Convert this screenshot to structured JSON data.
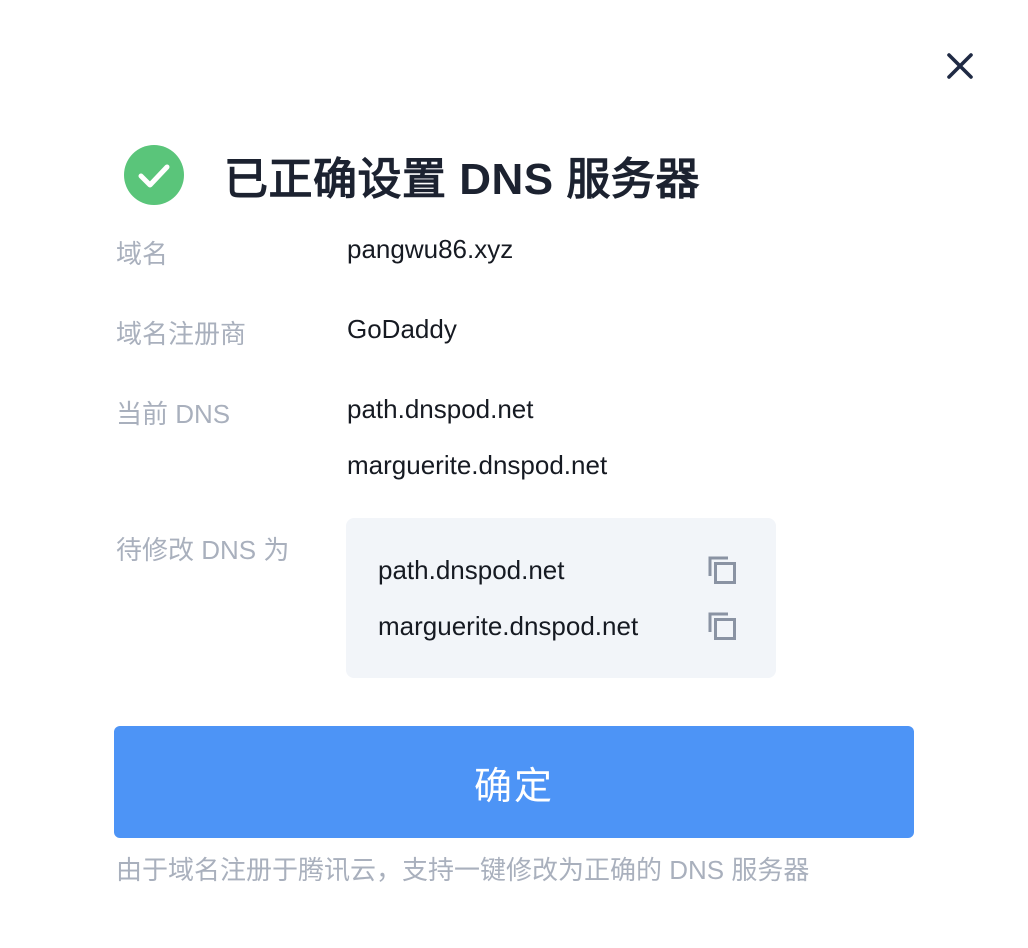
{
  "dialog": {
    "title": "已正确设置 DNS 服务器",
    "status_icon": "check-circle-icon",
    "close_icon": "close-icon",
    "accent_color": "#4d94f6",
    "success_color": "#5ac57a"
  },
  "fields": {
    "domain": {
      "label": "域名",
      "value": "pangwu86.xyz"
    },
    "registrar": {
      "label": "域名注册商",
      "value": "GoDaddy"
    },
    "current_dns": {
      "label": "当前 DNS",
      "values": [
        "path.dnspod.net",
        "marguerite.dnspod.net"
      ]
    },
    "target_dns": {
      "label": "待修改 DNS 为",
      "values": [
        "path.dnspod.net",
        "marguerite.dnspod.net"
      ],
      "copy_icon": "copy-icon"
    }
  },
  "actions": {
    "confirm_label": "确定"
  },
  "footnote": "由于域名注册于腾讯云，支持一键修改为正确的 DNS 服务器"
}
